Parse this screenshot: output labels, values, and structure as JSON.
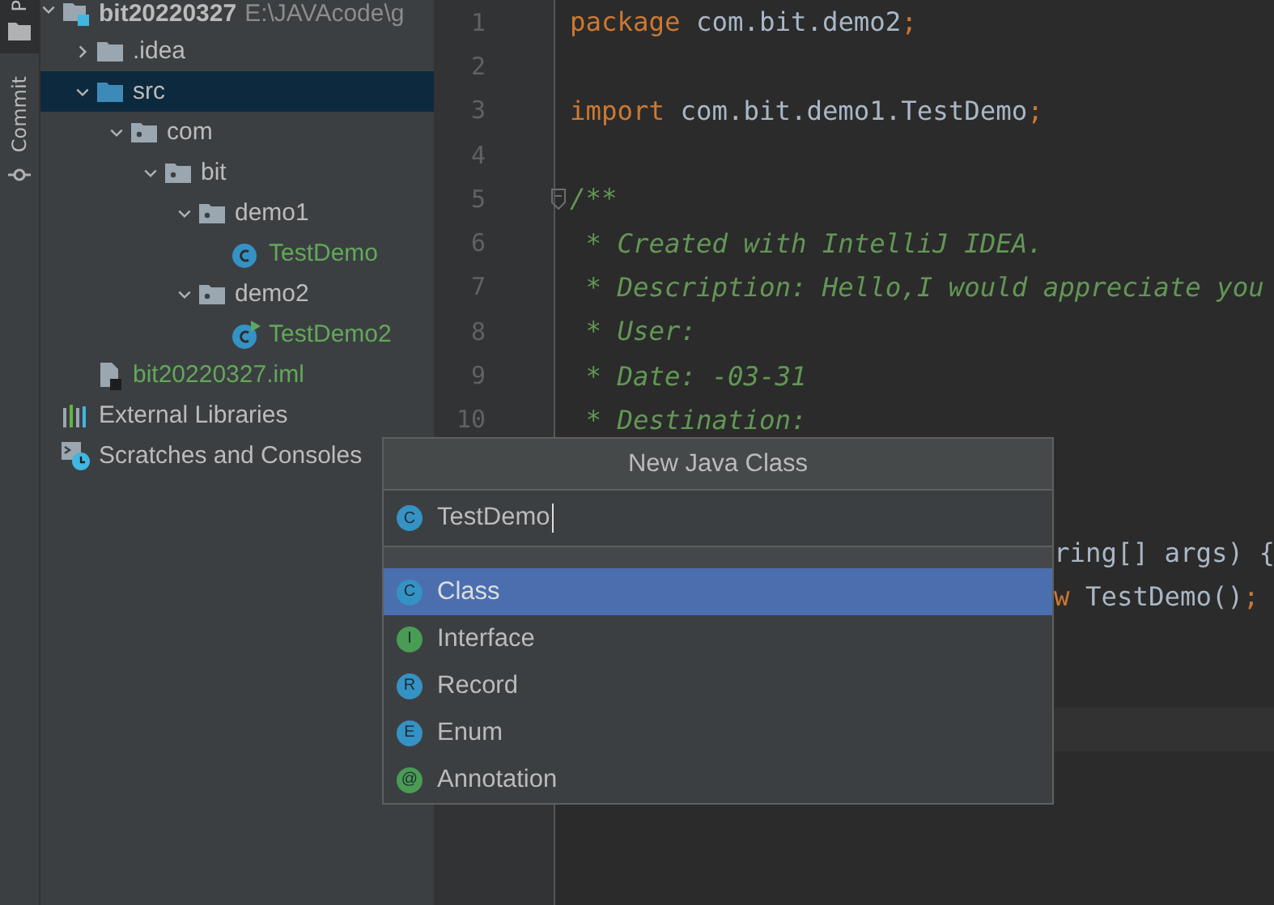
{
  "tool_strip": {
    "tabs": [
      {
        "label": "P",
        "kind": "project",
        "selected": true
      },
      {
        "label": "Commit",
        "kind": "commit",
        "selected": false
      }
    ]
  },
  "project_tree": {
    "items": [
      {
        "kind": "module",
        "label": "bit20220327",
        "path": "E:\\JAVAcode\\g",
        "expanded": true,
        "selected": false,
        "color": "#bbbbbb",
        "children": [
          {
            "kind": "folder",
            "label": ".idea",
            "expanded": false,
            "selected": false,
            "color": "#bbbbbb"
          },
          {
            "kind": "source-folder",
            "label": "src",
            "expanded": true,
            "selected": true,
            "color": "#bbbbbb",
            "children": [
              {
                "kind": "package",
                "label": "com",
                "expanded": true,
                "selected": false,
                "color": "#bbbbbb",
                "children": [
                  {
                    "kind": "package",
                    "label": "bit",
                    "expanded": true,
                    "selected": false,
                    "color": "#bbbbbb",
                    "children": [
                      {
                        "kind": "package",
                        "label": "demo1",
                        "expanded": true,
                        "selected": false,
                        "color": "#bbbbbb",
                        "children": [
                          {
                            "kind": "class",
                            "label": "TestDemo",
                            "selected": false,
                            "color": "#62a85a"
                          }
                        ]
                      },
                      {
                        "kind": "package",
                        "label": "demo2",
                        "expanded": true,
                        "selected": false,
                        "color": "#bbbbbb",
                        "children": [
                          {
                            "kind": "main-class",
                            "label": "TestDemo2",
                            "selected": false,
                            "color": "#62a85a"
                          }
                        ]
                      }
                    ]
                  }
                ]
              }
            ]
          },
          {
            "kind": "iml-file",
            "label": "bit20220327.iml",
            "selected": false,
            "color": "#62a85a"
          }
        ]
      },
      {
        "kind": "libraries",
        "label": "External Libraries",
        "selected": false,
        "color": "#bbbbbb"
      },
      {
        "kind": "scratches",
        "label": "Scratches and Consoles",
        "selected": false,
        "color": "#bbbbbb"
      }
    ]
  },
  "editor": {
    "lines": [
      {
        "number": "1",
        "fold": false,
        "tokens": [
          {
            "kind": "keyword",
            "text": "package"
          },
          {
            "kind": "plain",
            "text": " com.bit.demo2"
          },
          {
            "kind": "keyword",
            "text": ";"
          }
        ]
      },
      {
        "number": "2",
        "fold": false
      },
      {
        "number": "3",
        "fold": false,
        "tokens": [
          {
            "kind": "keyword",
            "text": "import"
          },
          {
            "kind": "plain",
            "text": " com.bit.demo1.TestDemo"
          },
          {
            "kind": "keyword",
            "text": ";"
          }
        ]
      },
      {
        "number": "4",
        "fold": false
      },
      {
        "number": "5",
        "fold": true,
        "tokens": [
          {
            "kind": "comment",
            "text": "/**"
          }
        ]
      },
      {
        "number": "6",
        "fold": false,
        "tokens": [
          {
            "kind": "comment",
            "text": " * Created with IntelliJ IDEA."
          }
        ]
      },
      {
        "number": "7",
        "fold": false,
        "tokens": [
          {
            "kind": "comment",
            "text": " * Description: Hello,I would appreciate you"
          }
        ]
      },
      {
        "number": "8",
        "fold": false,
        "tokens": [
          {
            "kind": "comment",
            "text": " * User:"
          }
        ]
      },
      {
        "number": "9",
        "fold": false,
        "tokens": [
          {
            "kind": "comment",
            "text": " * Date: -03-31"
          }
        ]
      },
      {
        "number": "10",
        "fold": false,
        "tokens": [
          {
            "kind": "comment",
            "text": " * Destination:"
          }
        ]
      }
    ],
    "partial_lines": [
      {
        "tokens": [
          {
            "kind": "plain",
            "text": "ring[] args) {"
          }
        ]
      },
      {
        "tokens": [
          {
            "kind": "keyword",
            "text": "w"
          },
          {
            "kind": "plain",
            "text": " TestDemo()"
          },
          {
            "kind": "keyword",
            "text": ";"
          }
        ]
      }
    ]
  },
  "popup": {
    "title": "New Java Class",
    "name_field": {
      "icon_letter": "C",
      "value": "TestDemo"
    },
    "options": [
      {
        "icon_letter": "C",
        "label": "Class",
        "kind": "class",
        "selected": true
      },
      {
        "icon_letter": "I",
        "label": "Interface",
        "kind": "interface",
        "selected": false
      },
      {
        "icon_letter": "R",
        "label": "Record",
        "kind": "record",
        "selected": false
      },
      {
        "icon_letter": "E",
        "label": "Enum",
        "kind": "enum",
        "selected": false
      },
      {
        "icon_letter": "@",
        "label": "Annotation",
        "kind": "annotation",
        "selected": false
      }
    ]
  }
}
